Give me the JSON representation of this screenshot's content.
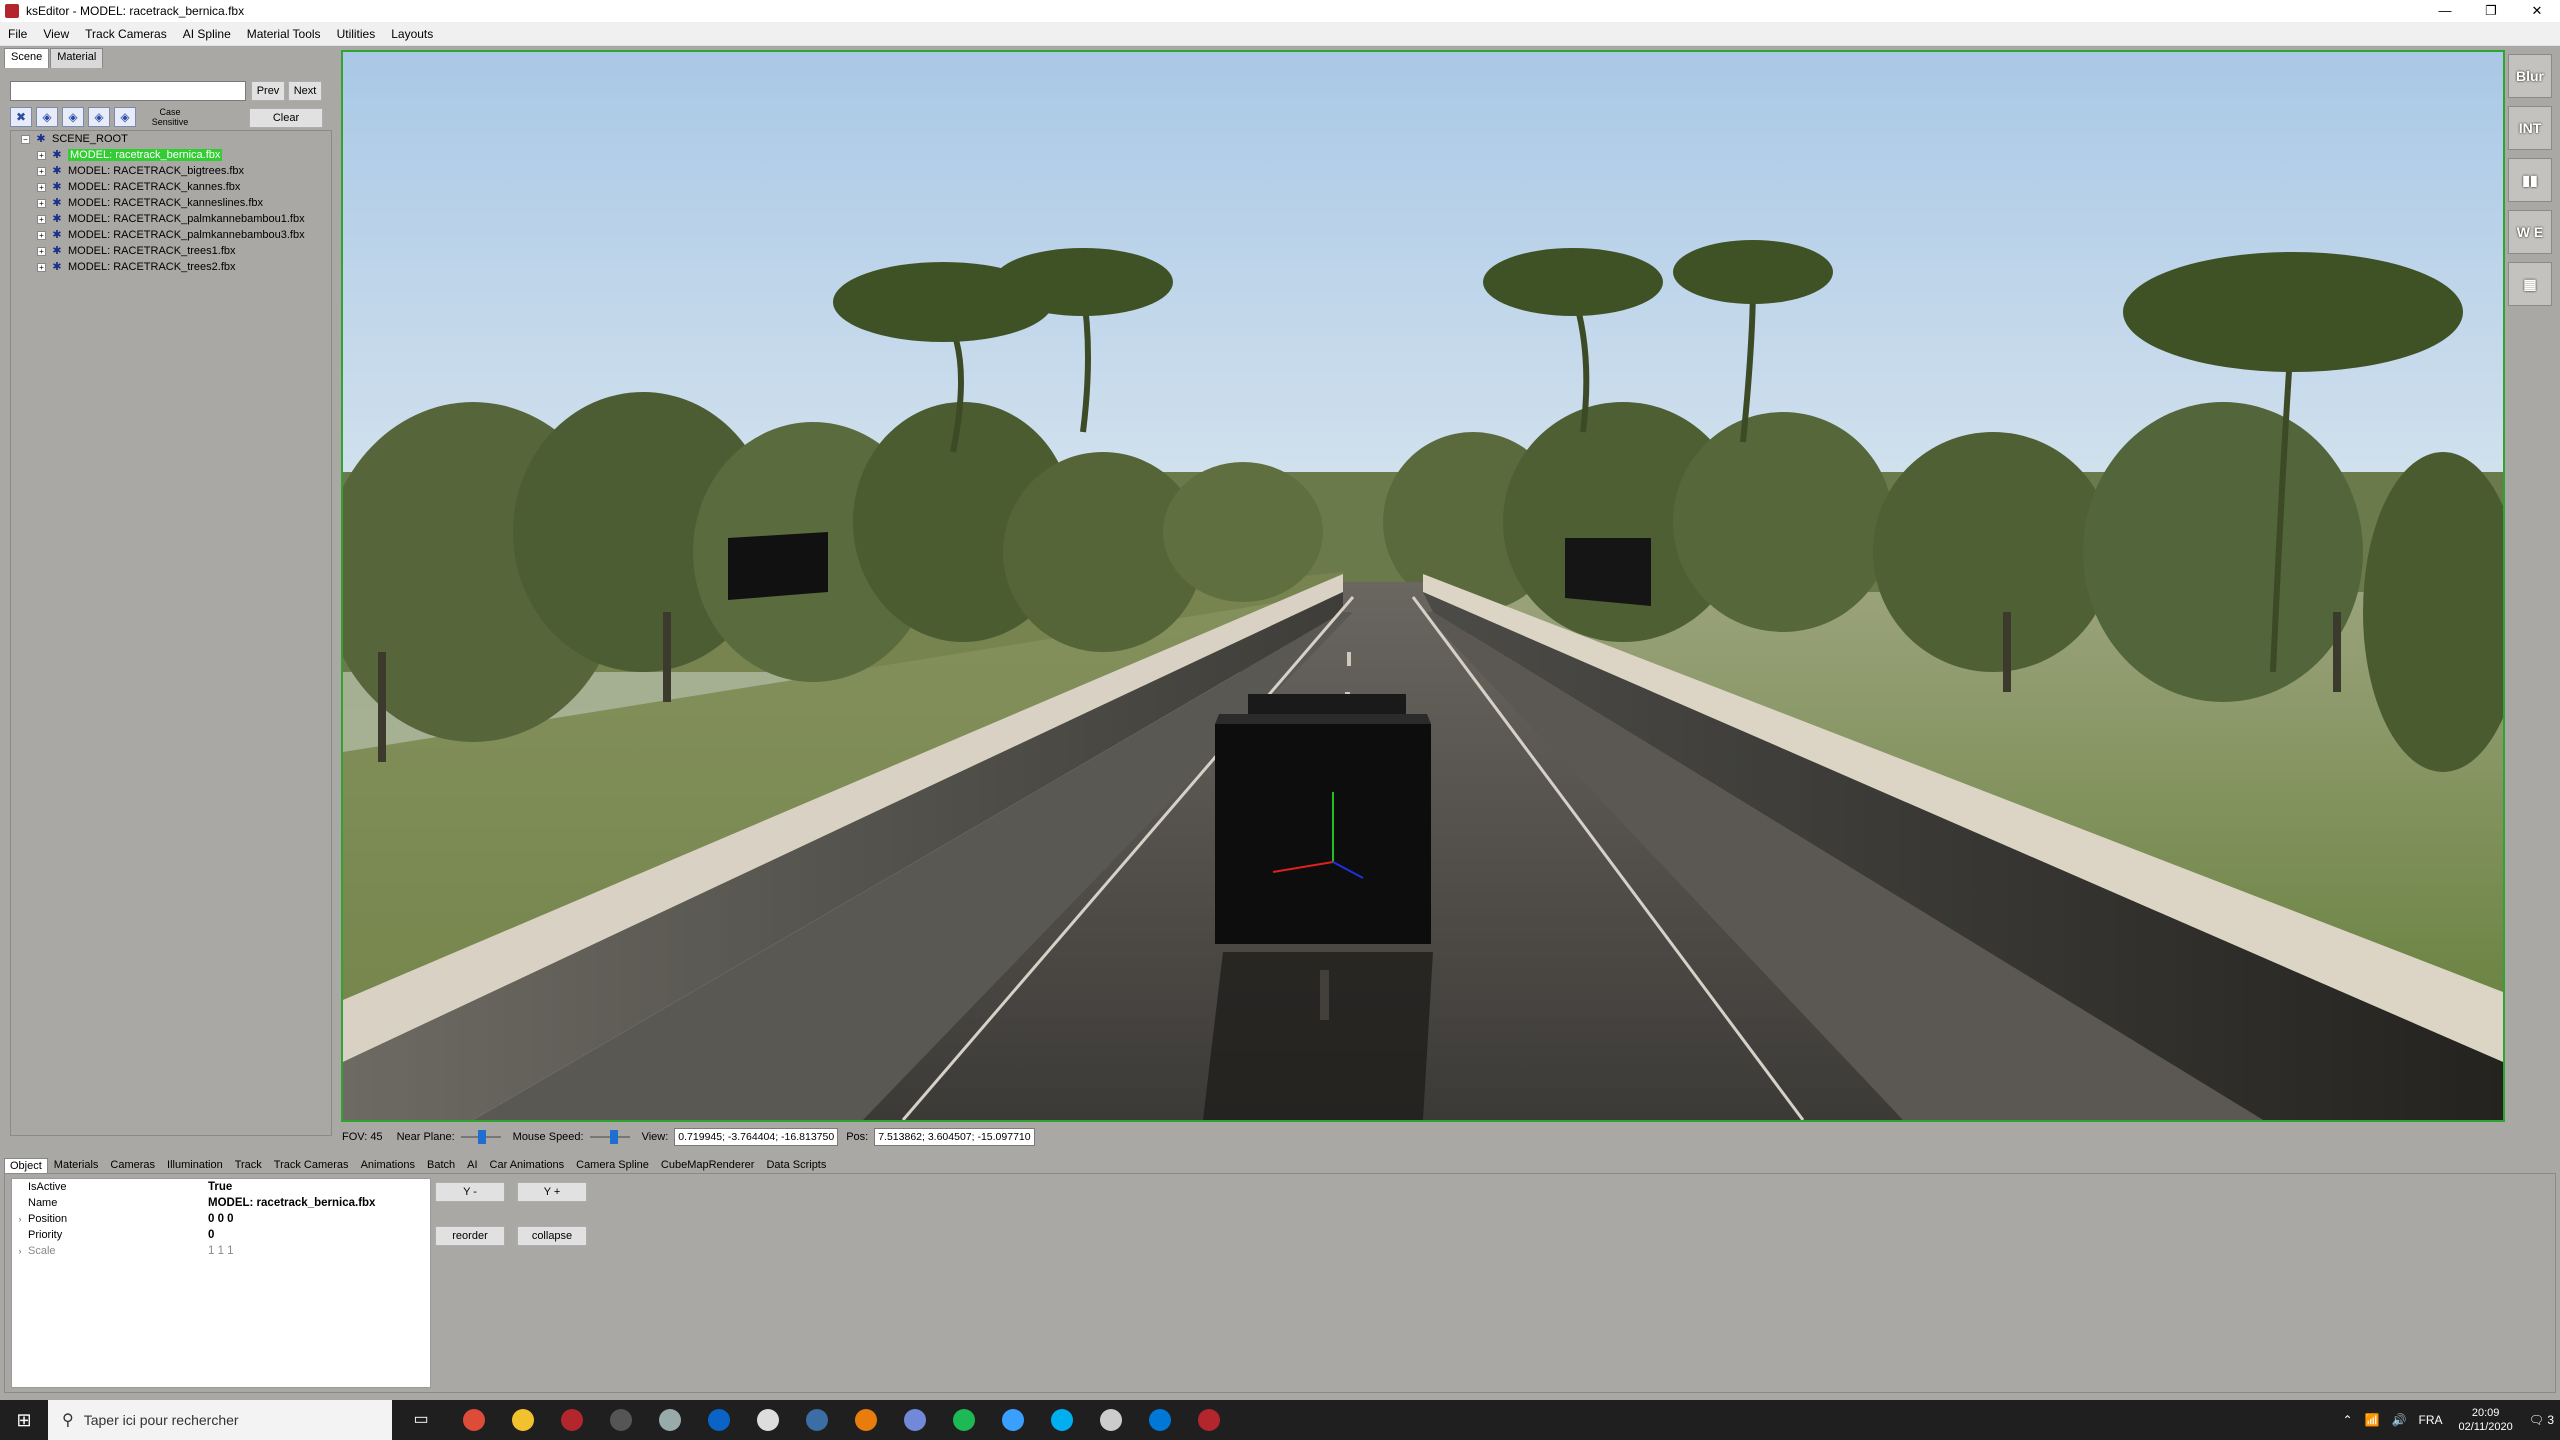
{
  "window": {
    "title": "ksEditor - MODEL: racetrack_bernica.fbx",
    "minimize": "—",
    "restore": "❐",
    "close": "✕"
  },
  "menu": [
    "File",
    "View",
    "Track Cameras",
    "AI Spline",
    "Material Tools",
    "Utilities",
    "Layouts"
  ],
  "left_tabs": [
    "Scene",
    "Material"
  ],
  "search": {
    "value": "",
    "prev": "Prev",
    "next": "Next",
    "case_sensitive": "Case Sensitive",
    "clear": "Clear"
  },
  "tree": {
    "root": "SCENE_ROOT",
    "items": [
      "MODEL: racetrack_bernica.fbx",
      "MODEL: RACETRACK_bigtrees.fbx",
      "MODEL: RACETRACK_kannes.fbx",
      "MODEL: RACETRACK_kanneslines.fbx",
      "MODEL: RACETRACK_palmkannebambou1.fbx",
      "MODEL: RACETRACK_palmkannebambou3.fbx",
      "MODEL: RACETRACK_trees1.fbx",
      "MODEL: RACETRACK_trees2.fbx"
    ],
    "selected_index": 0
  },
  "status": {
    "fov": "FOV: 45",
    "near_plane_label": "Near Plane:",
    "near_plane_level": 0.55,
    "mouse_speed_label": "Mouse Speed:",
    "mouse_speed_level": 0.65,
    "view_label": "View:",
    "view_value": "0.719945; -3.764404; -16.813750",
    "pos_label": "Pos:",
    "pos_value": "7.513862; 3.604507; -15.097710"
  },
  "bottom_tabs": [
    "Object",
    "Materials",
    "Cameras",
    "Illumination",
    "Track",
    "Track Cameras",
    "Animations",
    "Batch",
    "AI",
    "Car Animations",
    "Camera Spline",
    "CubeMapRenderer",
    "Data Scripts"
  ],
  "properties": [
    {
      "name": "IsActive",
      "value": "True",
      "expandable": false,
      "dim": false
    },
    {
      "name": "Name",
      "value": "MODEL: racetrack_bernica.fbx",
      "expandable": false,
      "dim": false
    },
    {
      "name": "Position",
      "value": "0 0 0",
      "expandable": true,
      "dim": false
    },
    {
      "name": "Priority",
      "value": "0",
      "expandable": false,
      "dim": false
    },
    {
      "name": "Scale",
      "value": "1 1 1",
      "expandable": true,
      "dim": true
    }
  ],
  "object_buttons": {
    "y_minus": "Y -",
    "y_plus": "Y +",
    "reorder": "reorder",
    "collapse": "collapse"
  },
  "right_tools": {
    "blur": "Blur",
    "int": "INT",
    "we": "W E"
  },
  "taskbar": {
    "search_placeholder": "Taper ici pour rechercher",
    "language": "FRA",
    "time": "20:09",
    "date": "02/11/2020",
    "notifications": "3",
    "colors": {
      "chrome": "#dd4b39",
      "folder": "#f2c12e",
      "spotify": "#1db954",
      "skype": "#00aff0",
      "edge": "#0078d7",
      "steam": "#1b2838"
    }
  }
}
